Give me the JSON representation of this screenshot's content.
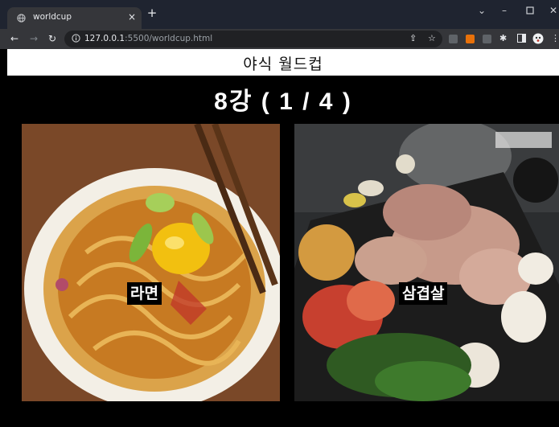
{
  "browser": {
    "tab_title": "worldcup",
    "url_host": "127.0.0.1",
    "url_rest": ":5500/worldcup.html",
    "new_tab_symbol": "+",
    "close_symbol": "×"
  },
  "page": {
    "site_title": "야식 월드컵",
    "round_title": "8강 ( 1 / 4 )"
  },
  "candidates": [
    {
      "label": "라면"
    },
    {
      "label": "삼겹살"
    }
  ],
  "colors": {
    "tabstrip": "#1f2430",
    "toolbar": "#35363a",
    "page_bg": "#000000",
    "header_bg": "#ffffff"
  },
  "icons": [
    "globe-icon",
    "close-icon",
    "plus-icon",
    "back-icon",
    "forward-icon",
    "reload-icon",
    "info-icon",
    "share-icon",
    "star-icon",
    "extension-icon",
    "puzzle-icon",
    "sidepanel-icon",
    "profile-icon",
    "menu-icon",
    "minimize-icon",
    "maximize-icon",
    "chevron-down-icon"
  ]
}
